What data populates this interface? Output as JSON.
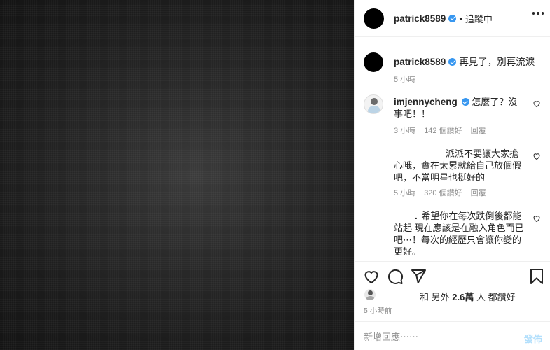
{
  "header": {
    "username": "patrick8589",
    "separator": "•",
    "follow_label": "追蹤中"
  },
  "caption": {
    "username": "patrick8589",
    "text": "再見了，別再流淚",
    "time": "5 小時"
  },
  "comments": [
    {
      "username": "imjennycheng",
      "text": "怎麼了？沒事吧！！",
      "time": "3 小時",
      "likes": "142 個讚好",
      "reply": "回覆"
    },
    {
      "username": "",
      "text": "派派不要讓大家擔心哦，實在太累就給自己放個假吧，不當明星也挺好的",
      "time": "5 小時",
      "likes": "320 個讚好",
      "reply": "回覆"
    },
    {
      "username": ".",
      "text": "希望你在每次跌倒後都能站起 現在應該是在融入角色而已吧⋯！每次的經歷只會讓你變的更好。",
      "time": "",
      "likes": "",
      "reply": ""
    }
  ],
  "likes": {
    "prefix": "和 另外",
    "count": "2.6萬",
    "suffix": "人 都讚好"
  },
  "post_time": "5 小時前",
  "add_comment": {
    "placeholder": "新增回應⋯⋯",
    "post_label": "發佈"
  },
  "icons": {
    "like": "heart-icon",
    "comment": "comment-bubble-icon",
    "share": "paper-plane-icon",
    "save": "bookmark-icon",
    "more": "more-dots-icon",
    "verified": "verified-badge-icon"
  },
  "colors": {
    "verified": "#3897f0",
    "muted_text": "#8e8e8e",
    "post_button_disabled": "#b2dffc"
  }
}
